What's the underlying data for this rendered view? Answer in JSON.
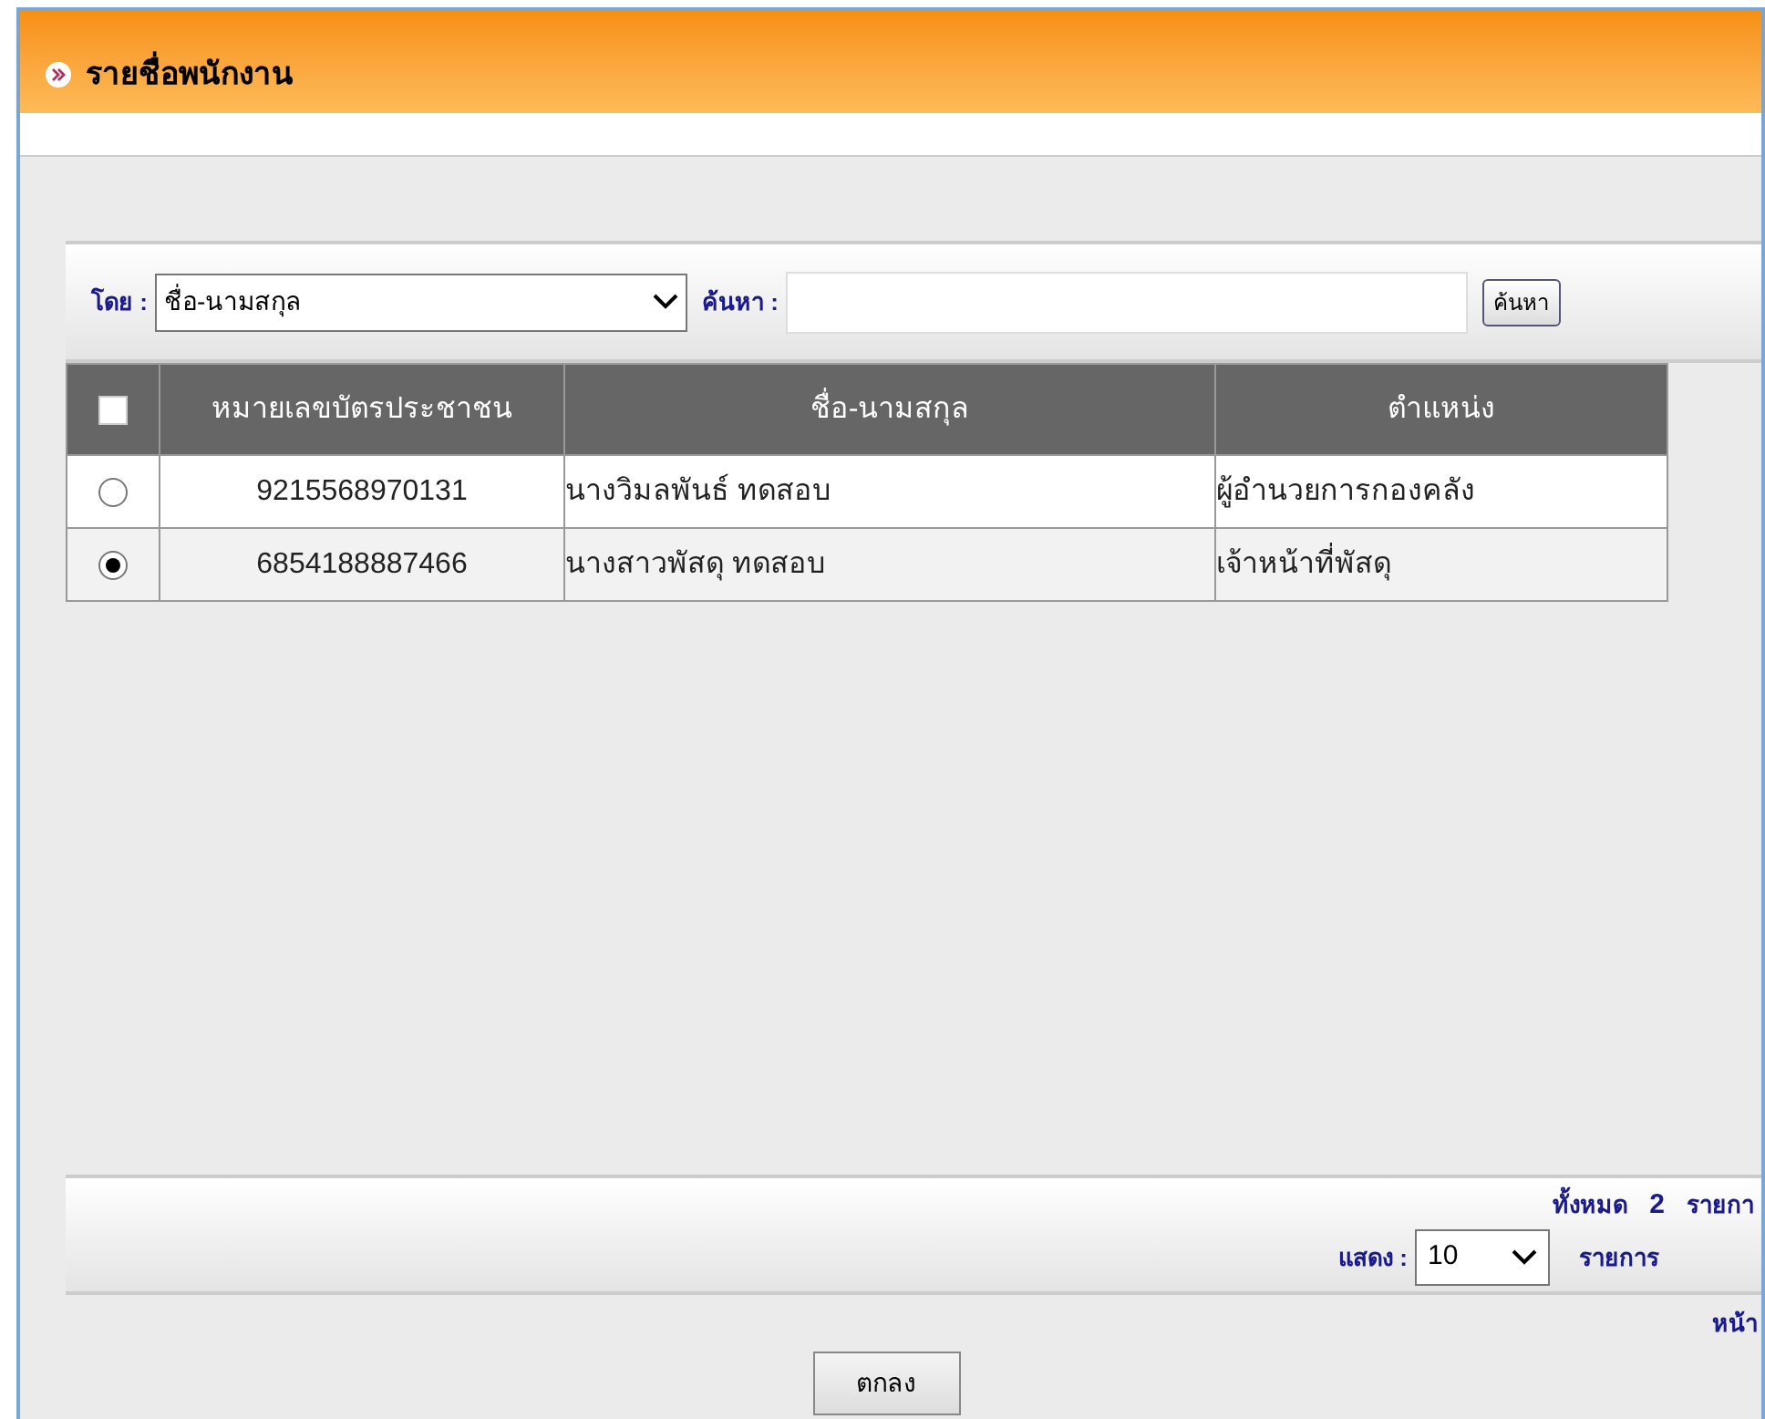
{
  "header": {
    "title": "รายชื่อพนักงาน"
  },
  "search": {
    "by_label": "โดย :",
    "by_value": "ชื่อ-นามสกุล",
    "query_label": "ค้นหา :",
    "button": "ค้นหา"
  },
  "table": {
    "select_all": {
      "checked": false
    },
    "columns": [
      "หมายเลขบัตรประชาชน",
      "ชื่อ-นามสกุล",
      "ตำแหน่ง"
    ],
    "rows": [
      {
        "selected": false,
        "id": "9215568970131",
        "name": "นางวิมลพันธ์ ทดสอบ",
        "position": "ผู้อำนวยการกองคลัง"
      },
      {
        "selected": true,
        "id": "6854188887466",
        "name": "นางสาวพัสดุ ทดสอบ",
        "position": "เจ้าหน้าที่พัสดุ"
      }
    ]
  },
  "footer": {
    "total_label": "ทั้งหมด",
    "total": "2",
    "total_unit": "รายกา",
    "show_label": "แสดง :",
    "page_size": "10",
    "show_unit": "รายการ",
    "page_label": "หน้า"
  },
  "ok_button": "ตกลง"
}
